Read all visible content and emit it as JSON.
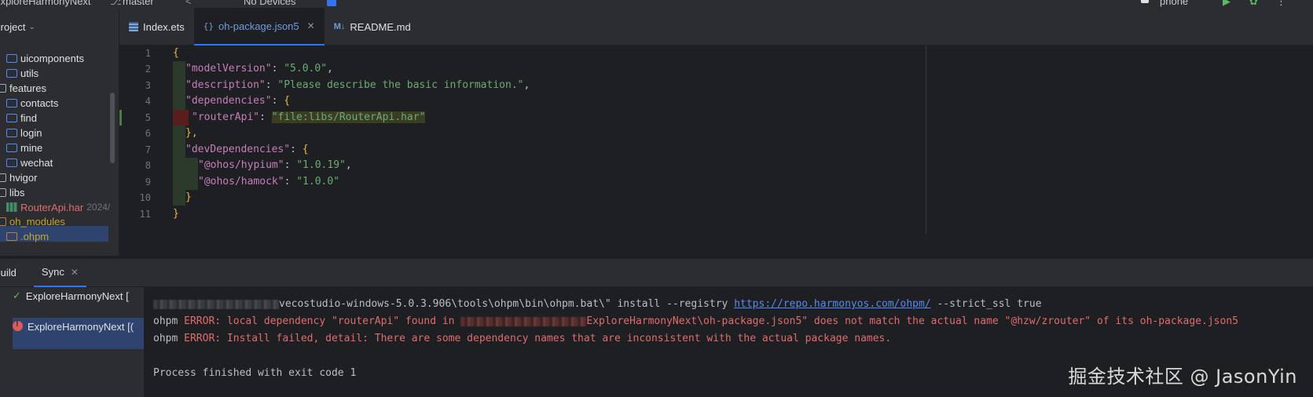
{
  "titlebar": {
    "project_name": "ExploreHarmonyNext",
    "branch": "master",
    "devices": "No Devices",
    "device_selector": "phone"
  },
  "project_panel": {
    "header": "Project",
    "items": [
      {
        "label": "uicomponents",
        "kind": "module"
      },
      {
        "label": "utils",
        "kind": "module"
      },
      {
        "label": "features",
        "kind": "folder"
      },
      {
        "label": "contacts",
        "kind": "module"
      },
      {
        "label": "find",
        "kind": "module"
      },
      {
        "label": "login",
        "kind": "module"
      },
      {
        "label": "mine",
        "kind": "module"
      },
      {
        "label": "wechat",
        "kind": "module"
      },
      {
        "label": "hvigor",
        "kind": "folder"
      },
      {
        "label": "libs",
        "kind": "folder"
      },
      {
        "label": "RouterApi.har",
        "kind": "har",
        "meta": "2024/"
      },
      {
        "label": "oh_modules",
        "kind": "folder"
      },
      {
        "label": ".ohpm",
        "kind": "folder"
      }
    ]
  },
  "editor_tabs": [
    {
      "label": "Index.ets",
      "icon": "ets-file-icon",
      "active": false
    },
    {
      "label": "oh-package.json5",
      "icon": "json-file-icon",
      "active": true
    },
    {
      "label": "README.md",
      "icon": "markdown-file-icon",
      "active": false
    }
  ],
  "editor": {
    "line_numbers": [
      "1",
      "2",
      "3",
      "4",
      "5",
      "6",
      "7",
      "8",
      "9",
      "10",
      "11"
    ],
    "lines": [
      {
        "t": "{"
      },
      {
        "k": "\"modelVersion\"",
        "v": "\"5.0.0\""
      },
      {
        "k": "\"description\"",
        "v": "\"Please describe the basic information.\""
      },
      {
        "k": "\"dependencies\"",
        "open": "{"
      },
      {
        "k": "\"routerApi\"",
        "v": "\"file:libs/RouterApi.har\""
      },
      {
        "t": "},"
      },
      {
        "k": "\"devDependencies\"",
        "open": "{"
      },
      {
        "k": "\"@ohos/hypium\"",
        "v": "\"1.0.19\""
      },
      {
        "k": "\"@ohos/hamock\"",
        "v": "\"1.0.0\""
      },
      {
        "t": "}"
      },
      {
        "t": "}"
      }
    ]
  },
  "bottom_panel": {
    "tabs": [
      {
        "label": "Build",
        "active": false
      },
      {
        "label": "Sync",
        "active": true
      }
    ],
    "sync_items": [
      {
        "label": "ExploreHarmonyNext [",
        "status": "success"
      },
      {
        "label": "ExploreHarmonyNext [(",
        "status": "error"
      }
    ],
    "console": {
      "line1_a": "vecostudio-windows-5.0.3.906\\tools\\ohpm\\bin\\ohpm.bat\\\" install --registry ",
      "line1_link": "https://repo.harmonyos.com/ohpm/",
      "line1_b": " --strict_ssl true",
      "line2_prefix": "ohpm ",
      "line2_error": "ERROR: local dependency \"routerApi\" found in ",
      "line2_b": "ExploreHarmonyNext\\oh-package.json5\" does not match the actual name \"@hzw/zrouter\" of its oh-package.json5",
      "line3_prefix": "ohpm ",
      "line3_error": "ERROR: Install failed, detail: There are some dependency names that are inconsistent with the actual package names.",
      "line5": "Process finished with exit code 1"
    }
  },
  "watermark": "掘金技术社区 @ JasonYin",
  "colors": {
    "accent": "#3574f0",
    "error": "#e06c6c",
    "string": "#6aab73",
    "key": "#c77dbb",
    "brace": "#e8ba36"
  }
}
